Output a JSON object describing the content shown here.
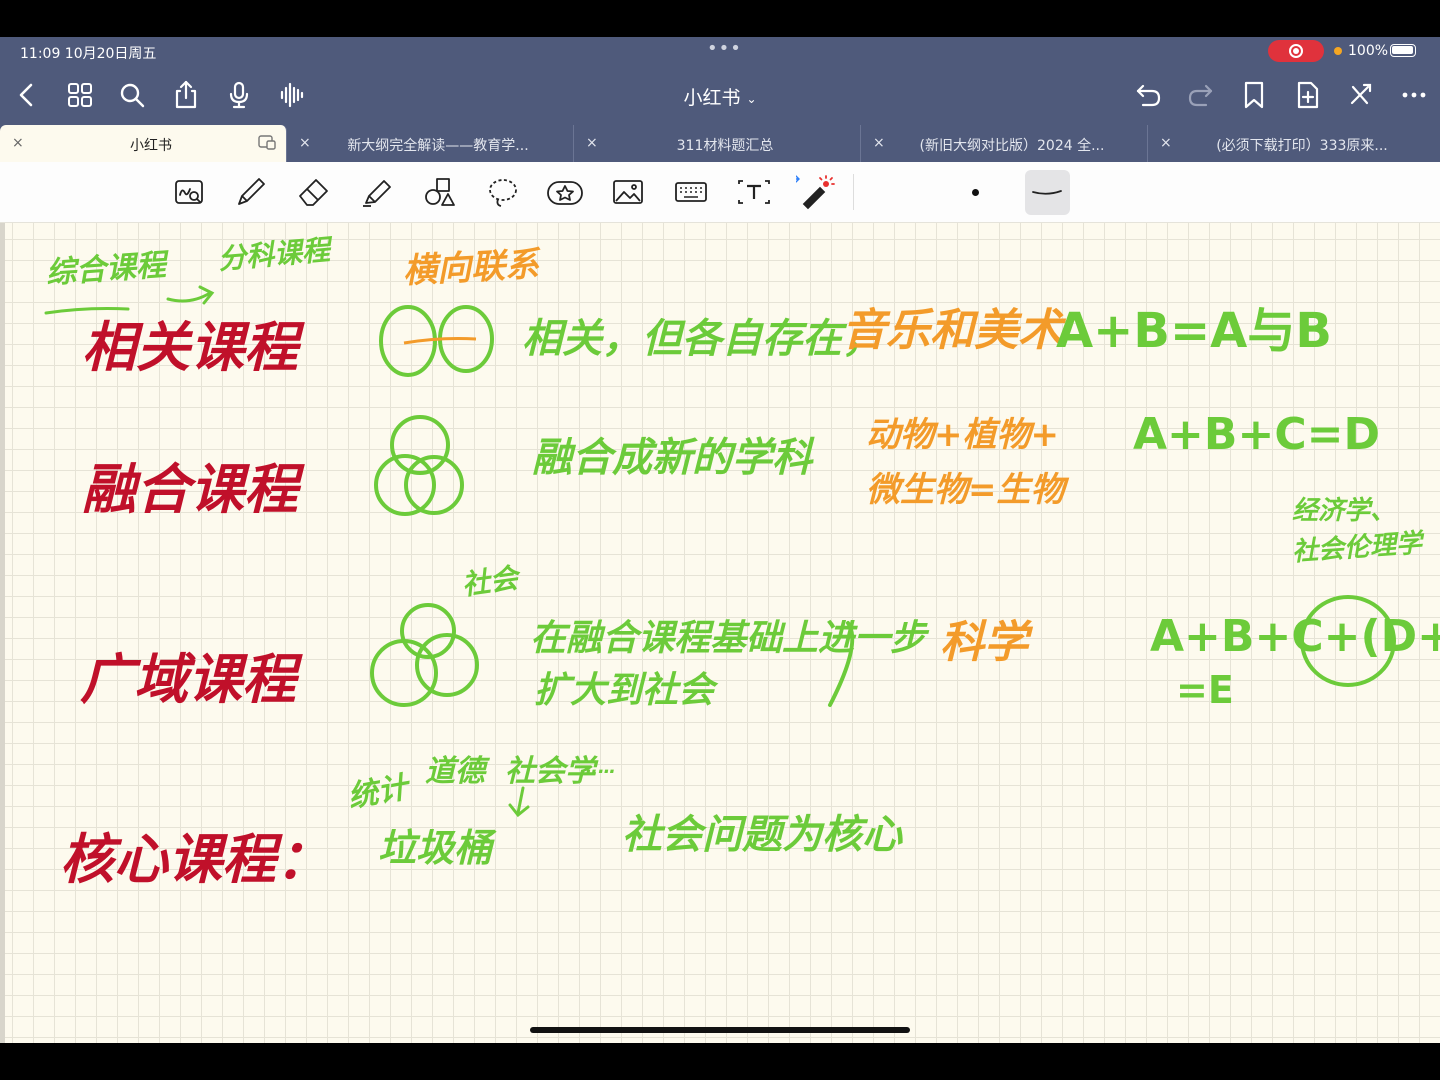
{
  "status_bar": {
    "time": "11:09  10月20日周五",
    "dots": "•••",
    "battery": "100%"
  },
  "nav": {
    "title": "小红书",
    "title_chevron": "⌄"
  },
  "tabs": [
    {
      "label": "小红书",
      "active": true
    },
    {
      "label": "新大纲完全解读——教育学..."
    },
    {
      "label": "311材料题汇总"
    },
    {
      "label": "(新旧大纲对比版）2024 全..."
    },
    {
      "label": "(必须下载打印）333原来..."
    }
  ],
  "tab_close": "×",
  "notes": {
    "header": {
      "left": "综合课程",
      "arrow_to": "分科课程",
      "green_title": "横向联系"
    },
    "r1": {
      "title": "相关课程",
      "desc": "相关，但各自存在，",
      "example": "音乐和美术",
      "formula": "A+B=A与B"
    },
    "r2": {
      "title": "融合课程",
      "desc": "融合成新的学科",
      "example_line1": "动物+植物+",
      "example_line2": "微生物=生物",
      "formula": "A+B+C=D"
    },
    "r3": {
      "title": "广域课程",
      "side": "社会",
      "desc_line1": "在融合课程基础上进一步",
      "desc_line2": "扩大到社会",
      "example": "科学",
      "note_line1": "经济学、",
      "note_line2": "社会伦理学",
      "formula_line1": "A+B+C+(D+E)",
      "formula_line2": "=E"
    },
    "r4": {
      "title": "核心课程：",
      "top1": "统计",
      "top2": "道德",
      "top3": "社会学",
      "dots": "……",
      "bottom": "垃圾桶",
      "desc": "社会问题为核心"
    }
  },
  "colors": {
    "header": "#4f5a7b",
    "red_ink": "#c0102a",
    "green_ink": "#6ccb3a",
    "orange_ink": "#f39b2a",
    "paper": "#fdfaee"
  }
}
